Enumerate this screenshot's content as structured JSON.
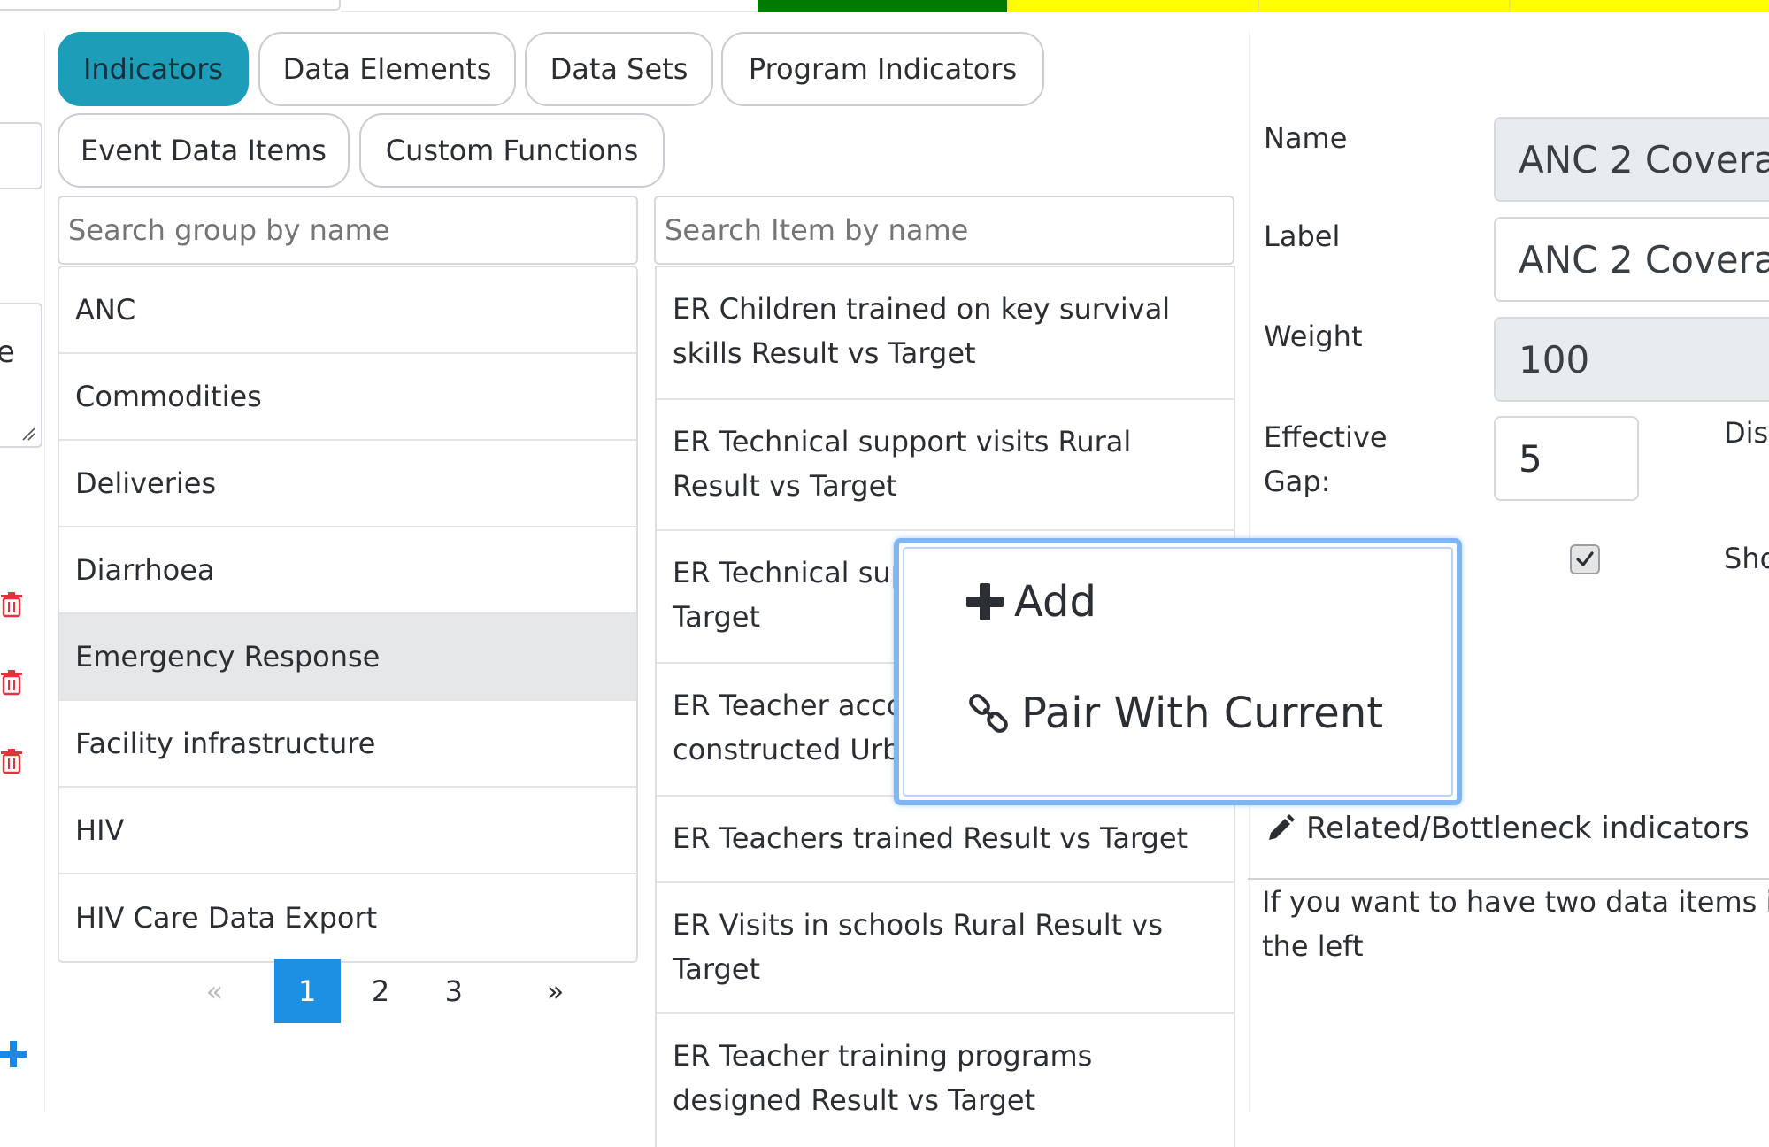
{
  "top": {
    "progress_colors": [
      "#007a00",
      "#ffff00",
      "#ffff00",
      "#ffff00",
      "#ffff00"
    ]
  },
  "left_column": {
    "textarea_fragment": "e"
  },
  "tabs": [
    {
      "label": "Indicators",
      "active": true
    },
    {
      "label": "Data Elements",
      "active": false
    },
    {
      "label": "Data Sets",
      "active": false
    },
    {
      "label": "Program Indicators",
      "active": false
    },
    {
      "label": "Event Data Items",
      "active": false
    },
    {
      "label": "Custom Functions",
      "active": false
    }
  ],
  "search": {
    "group_placeholder": "Search group by name",
    "item_placeholder": "Search Item by name"
  },
  "groups": [
    "ANC",
    "Commodities",
    "Deliveries",
    "Diarrhoea",
    "Emergency Response",
    "Facility infrastructure",
    "HIV",
    "HIV Care Data Export"
  ],
  "selected_group": "Emergency Response",
  "pagination": {
    "prev": "«",
    "pages": [
      "1",
      "2",
      "3"
    ],
    "current": "1",
    "next": "»"
  },
  "items": [
    {
      "line1": "ER Children trained on key survival",
      "line2": "skills Result vs Target"
    },
    {
      "line1": "ER Technical support visits Rural",
      "line2": "Result vs Target"
    },
    {
      "line1": "ER Technical sup",
      "line2": "Target"
    },
    {
      "line1": "ER Teacher acco",
      "line2": "constructed Urb"
    },
    {
      "line1": "ER Teachers trained Result vs Target",
      "line2": ""
    },
    {
      "line1": "ER Visits in schools Rural Result vs",
      "line2": "Target"
    },
    {
      "line1": "ER Teacher training programs",
      "line2": "designed Result vs Target"
    }
  ],
  "form": {
    "name_label": "Name",
    "name_value": "ANC 2 Covera",
    "label_label": "Label",
    "label_value": "ANC 2 Covera",
    "weight_label": "Weight",
    "weight_value": "100",
    "gap_label_line1": "Effective",
    "gap_label_line2": "Gap:",
    "gap_value": "5",
    "dis_label": "Dis",
    "sho_label": "Sho",
    "checkbox_checked": true
  },
  "related": {
    "title": "Related/Bottleneck indicators",
    "help_line1": "If you want to have two data items i",
    "help_line2": "the left"
  },
  "context_menu": {
    "add_label": "Add",
    "pair_label": "Pair With Current"
  },
  "colors": {
    "accent": "#1e9db8",
    "pager_active": "#1e90e3",
    "delete_red": "#e0343d",
    "menu_border": "#7fb6f2"
  }
}
